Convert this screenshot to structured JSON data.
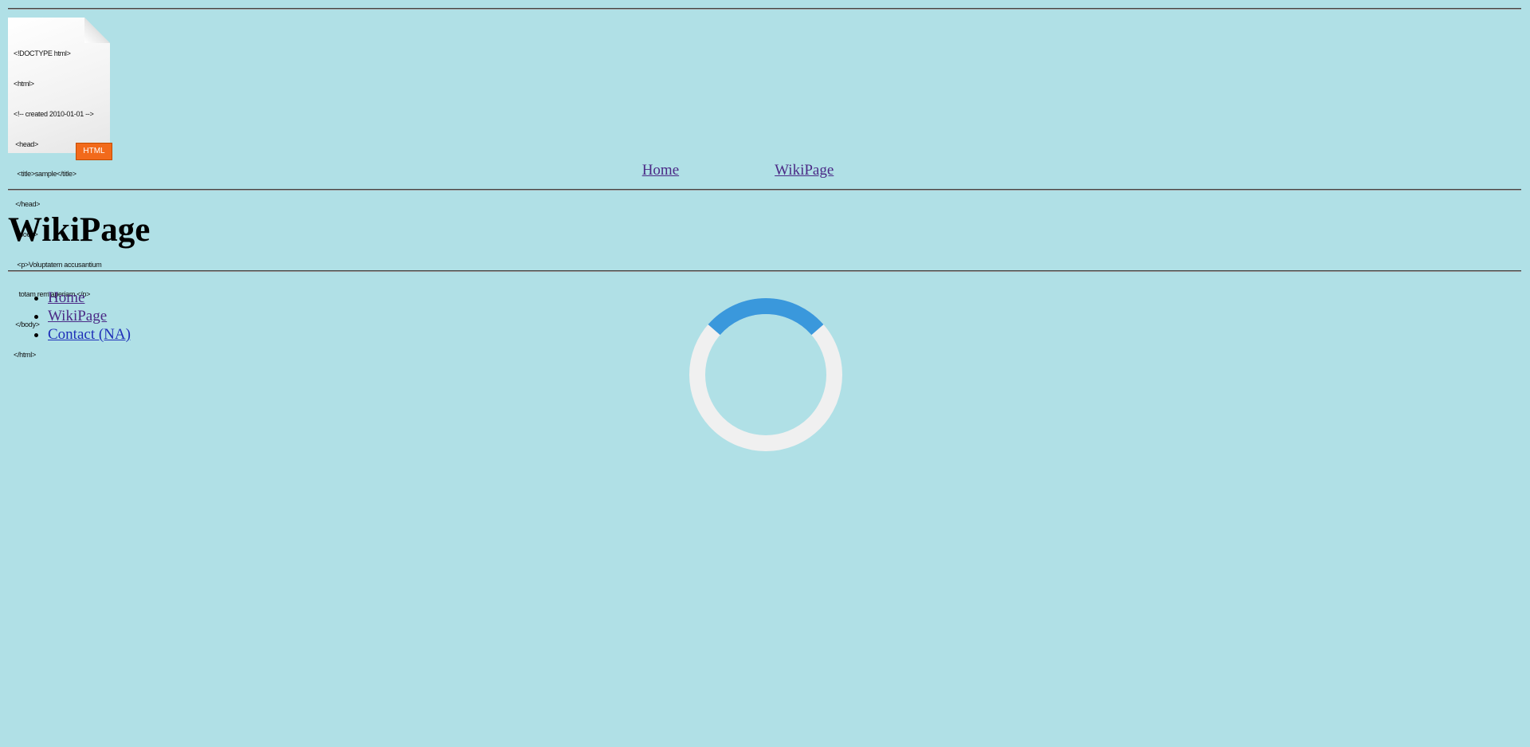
{
  "logo": {
    "code_lines": [
      "<!DOCTYPE html>",
      "<html>",
      "<!-- created 2010-01-01 -->",
      " <head>",
      "  <title>sample</title>",
      " </head>",
      " <body>",
      "  <p>Voluptatem accusantium",
      "   totam rem aperiam.</p>",
      " </body>",
      "</html>"
    ],
    "badge": "HTML"
  },
  "nav": {
    "home": "Home",
    "wikipage": "WikiPage"
  },
  "page": {
    "title": "WikiPage"
  },
  "sidebar": {
    "items": [
      {
        "label": "Home"
      },
      {
        "label": "WikiPage"
      },
      {
        "label": "Contact (NA)"
      }
    ]
  },
  "colors": {
    "background": "#b0e0e6",
    "link": "#4b2a86",
    "spinner_track": "#f0f0f0",
    "spinner_arc": "#3a98dc"
  }
}
